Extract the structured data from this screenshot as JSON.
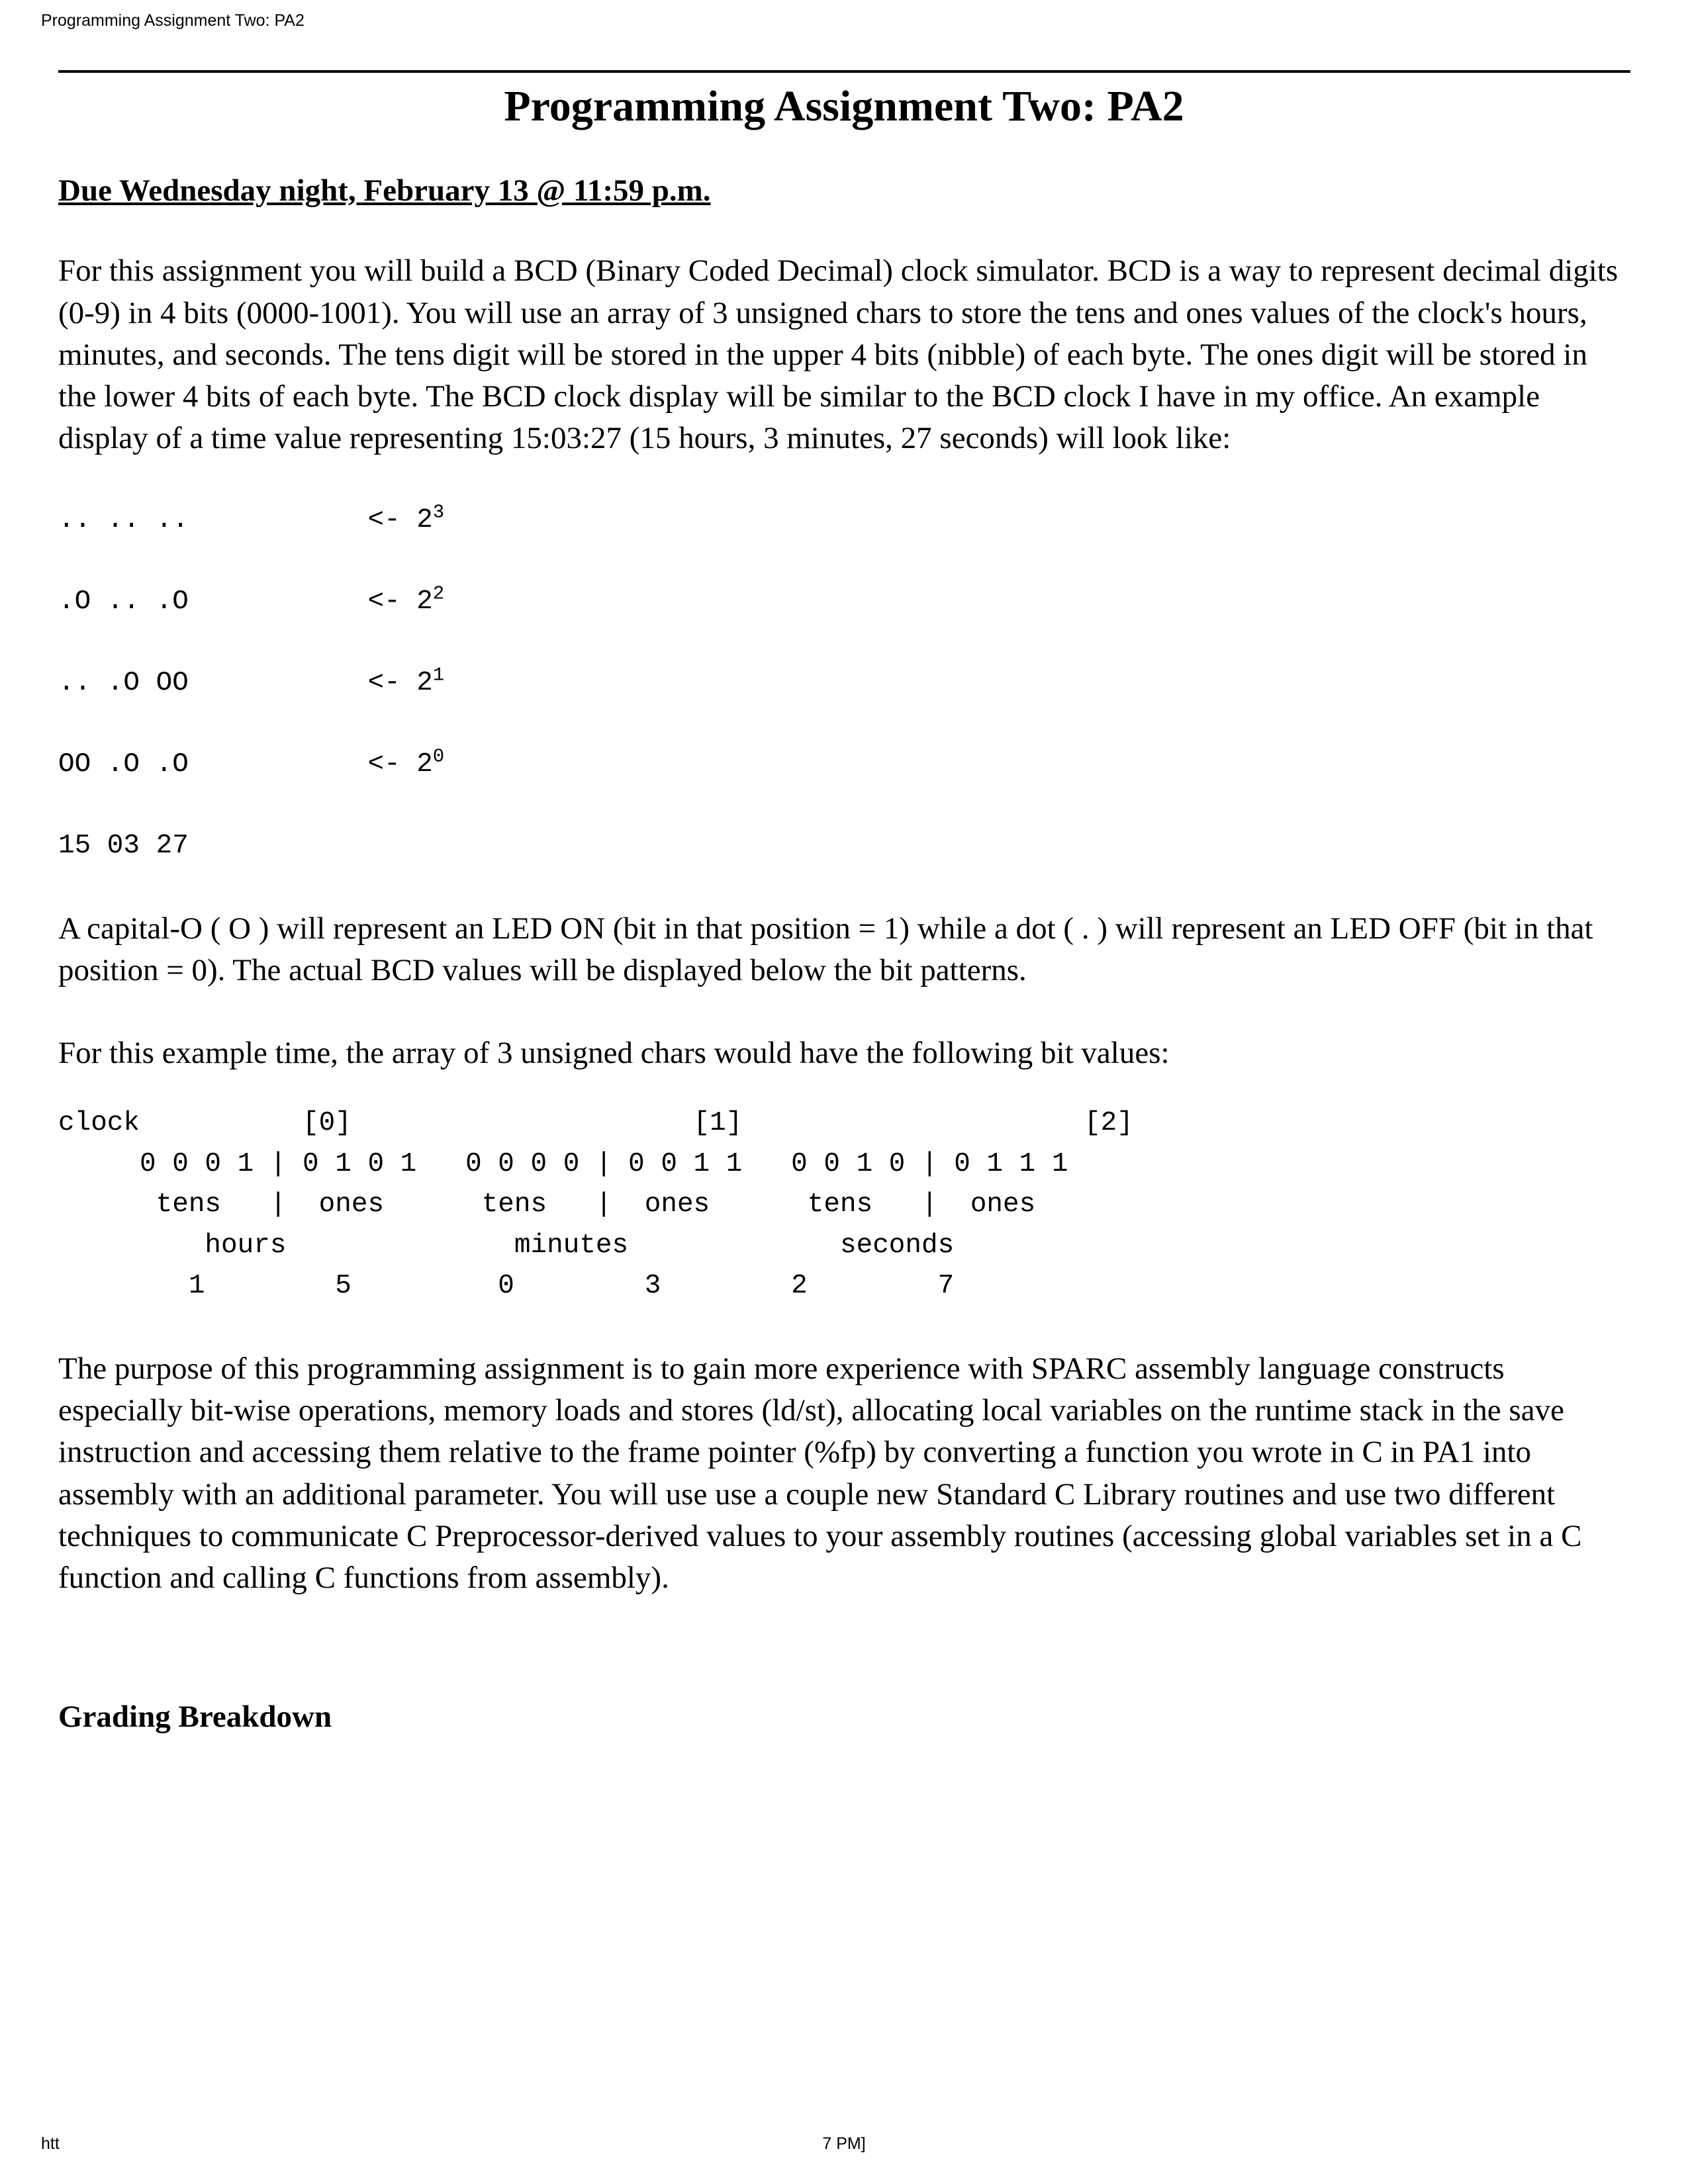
{
  "print_header": {
    "left": "Programming Assignment Two: PA2"
  },
  "print_footer": {
    "left": "htt",
    "center": "7 PM]"
  },
  "document": {
    "title": "Programming Assignment Two: PA2",
    "due_heading": "Due Wednesday night, February 13 @ 11:59 p.m.",
    "intro_paragraph": "For this assignment you will build a BCD (Binary Coded Decimal) clock simulator. BCD is a way to represent decimal digits (0-9) in 4 bits (0000-1001). You will use an array of 3 unsigned chars to store the tens and ones values of the clock's hours, minutes, and seconds. The tens digit will be stored in the upper 4 bits (nibble) of each byte. The ones digit will be stored in the lower 4 bits of each byte. The BCD clock display will be similar to the BCD clock I have in my office. An example display of a time value representing 15:03:27 (15 hours, 3 minutes, 27 seconds) will look like:",
    "legend_paragraph": "A capital-O ( O ) will represent an LED ON (bit in that position = 1) while a dot ( . ) will represent an LED OFF (bit in that position = 0). The actual BCD values will be displayed below the bit patterns.",
    "example_lead_paragraph": "For this example time, the array of 3 unsigned chars would have the following bit values:",
    "purpose_paragraph": "The purpose of this programming assignment is to gain more experience with SPARC assembly language constructs especially bit-wise operations, memory loads and stores (ld/st), allocating local variables on the runtime stack in the save instruction and accessing them relative to the frame pointer (%fp) by converting a function you wrote in C in PA1 into assembly with an additional parameter. You will use use a couple new Standard C Library routines and use two different techniques to communicate C Preprocessor-derived values to your assembly routines (accessing global variables set in a C function and calling C functions from assembly).",
    "grading_heading": "Grading Breakdown"
  },
  "led_display": {
    "rows": [
      {
        "pattern": ".. .. ..",
        "arrow": "<- 2",
        "exp": "3"
      },
      {
        "pattern": ".O .. .O",
        "arrow": "<- 2",
        "exp": "2"
      },
      {
        "pattern": ".. .O OO",
        "arrow": "<- 2",
        "exp": "1"
      },
      {
        "pattern": "OO .O .O",
        "arrow": "<- 2",
        "exp": "0"
      }
    ],
    "values_row": "15 03 27"
  },
  "bit_table": {
    "line_index": "clock          [0]                     [1]                     [2]",
    "line_bits": "     0 0 0 1 | 0 1 0 1   0 0 0 0 | 0 0 1 1   0 0 1 0 | 0 1 1 1",
    "line_nibble": "      tens   |  ones      tens   |  ones      tens   |  ones",
    "line_unit": "         hours              minutes             seconds",
    "line_digits": "        1        5         0        3        2        7"
  }
}
